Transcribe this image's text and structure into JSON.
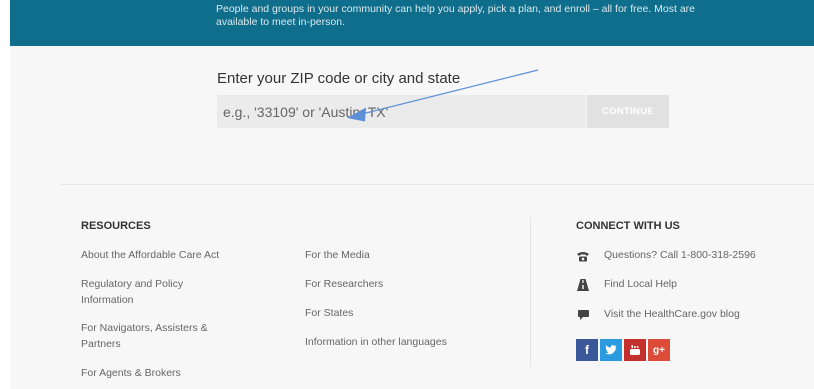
{
  "banner": {
    "text": "People and groups in your community can help you apply, pick a plan, and enroll – all for free. Most are available to meet in-person."
  },
  "zip_search": {
    "label": "Enter your ZIP code or city and state",
    "placeholder": "e.g., '33109' or 'Austin, TX'",
    "button_label": "CONTINUE"
  },
  "resources": {
    "heading": "RESOURCES",
    "col1": [
      "About the Affordable Care Act",
      "Regulatory and Policy Information",
      "For Navigators, Assisters & Partners",
      "For Agents & Brokers"
    ],
    "col2": [
      "For the Media",
      "For Researchers",
      "For States",
      "Information in other languages"
    ]
  },
  "connect": {
    "heading": "CONNECT WITH US",
    "items": [
      {
        "label": "Questions? Call 1-800-318-2596",
        "icon": "phone-icon"
      },
      {
        "label": "Find Local Help",
        "icon": "road-icon"
      },
      {
        "label": "Visit the HealthCare.gov blog",
        "icon": "comment-icon"
      }
    ],
    "social": [
      {
        "name": "facebook",
        "glyph": "f",
        "color": "#3b5998"
      },
      {
        "name": "twitter",
        "glyph": "🐦",
        "color": "#2a9be0"
      },
      {
        "name": "youtube",
        "glyph": "▶",
        "color": "#c4302b"
      },
      {
        "name": "google-plus",
        "glyph": "g+",
        "color": "#dd4b39"
      }
    ]
  },
  "colors": {
    "banner": "#0e6e8c",
    "annotation_arrow": "#5b8fd8"
  }
}
